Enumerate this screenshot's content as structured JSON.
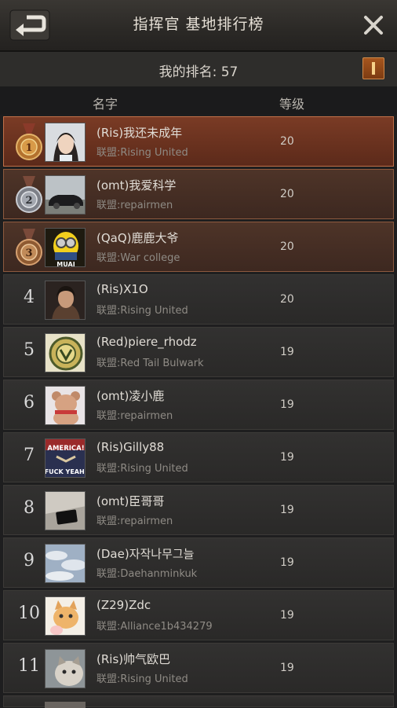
{
  "header": {
    "title": "指挥官 基地排行榜"
  },
  "my_rank": {
    "label": "我的排名: 57"
  },
  "columns": {
    "name": "名字",
    "level": "等级"
  },
  "rows": [
    {
      "rank": "1",
      "name": "(Ris)我还未成年",
      "alliance": "联盟:Rising United",
      "level": "20",
      "avatar": "woman-portrait"
    },
    {
      "rank": "2",
      "name": "(omt)我爱科学",
      "alliance": "联盟:repairmen",
      "level": "20",
      "avatar": "car"
    },
    {
      "rank": "3",
      "name": "(QaQ)鹿鹿大爷",
      "alliance": "联盟:War college",
      "level": "20",
      "avatar": "minion"
    },
    {
      "rank": "4",
      "name": "(Ris)X1O",
      "alliance": "联盟:Rising United",
      "level": "20",
      "avatar": "man-portrait"
    },
    {
      "rank": "5",
      "name": "(Red)piere_rhodz",
      "alliance": "联盟:Red Tail Bulwark",
      "level": "19",
      "avatar": "emblem"
    },
    {
      "rank": "6",
      "name": "(omt)凌小鹿",
      "alliance": "联盟:repairmen",
      "level": "19",
      "avatar": "teddy-bear"
    },
    {
      "rank": "7",
      "name": "(Ris)Gilly88",
      "alliance": "联盟:Rising United",
      "level": "19",
      "avatar": "america-text"
    },
    {
      "rank": "8",
      "name": "(omt)臣哥哥",
      "alliance": "联盟:repairmen",
      "level": "19",
      "avatar": "phone"
    },
    {
      "rank": "9",
      "name": "(Dae)자작나무그늘",
      "alliance": "联盟:Daehanminkuk",
      "level": "19",
      "avatar": "clouds"
    },
    {
      "rank": "10",
      "name": "(Z29)Zdc",
      "alliance": "联盟:Alliance1b434279",
      "level": "19",
      "avatar": "cat-cartoon"
    },
    {
      "rank": "11",
      "name": "(Ris)帅气欧巴",
      "alliance": "联盟:Rising United",
      "level": "19",
      "avatar": "cat-photo"
    }
  ],
  "avatar_texts": {
    "minion": "MUAI",
    "america_line1": "AMERICA!",
    "america_line2": "FUCK YEAH!"
  },
  "colors": {
    "top1_bg": "#7a3b25",
    "top23_bg": "#4e3428",
    "row_bg": "#2e2d2c",
    "accent": "#a6561e"
  }
}
